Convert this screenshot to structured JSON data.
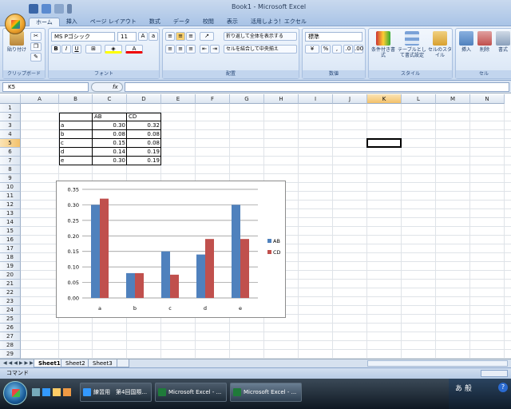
{
  "window": {
    "title": "Book1 - Microsoft Excel"
  },
  "ribbon": {
    "tabs": [
      "ホーム",
      "挿入",
      "ページ レイアウト",
      "数式",
      "データ",
      "校閲",
      "表示",
      "活用しよう！エクセル"
    ],
    "clipboard": {
      "paste_label": "貼り付け",
      "group_label": "クリップボード"
    },
    "font": {
      "name": "MS Pゴシック",
      "size": "11",
      "bold": "B",
      "italic": "I",
      "underline": "U",
      "group_label": "フォント"
    },
    "alignment": {
      "wrap_label": "折り返して全体を表示する",
      "merge_label": "セルを結合して中央揃え",
      "group_label": "配置"
    },
    "number": {
      "format": "標準",
      "group_label": "数値"
    },
    "styles": {
      "conditional_label": "条件付き書式",
      "table_label": "テーブルとして書式設定",
      "cell_styles_label": "セルのスタイル",
      "group_label": "スタイル"
    },
    "cells": {
      "insert_label": "挿入",
      "delete_label": "削除",
      "format_label": "書式",
      "group_label": "セル"
    }
  },
  "formula_bar": {
    "name_box": "K5",
    "fx": "fx",
    "content": ""
  },
  "columns": [
    "A",
    "B",
    "C",
    "D",
    "E",
    "F",
    "G",
    "H",
    "I",
    "J",
    "K",
    "L",
    "M",
    "N"
  ],
  "selected_column": "K",
  "rows": [
    "1",
    "2",
    "3",
    "4",
    "5",
    "6",
    "7",
    "8",
    "9",
    "10",
    "11",
    "12",
    "13",
    "14",
    "15",
    "16",
    "17",
    "18",
    "19",
    "20",
    "21",
    "22",
    "23",
    "24",
    "25",
    "26",
    "27",
    "28",
    "29"
  ],
  "selected_row": "5",
  "table": {
    "headers": [
      "AB",
      "CD"
    ],
    "rows": [
      {
        "label": "a",
        "ab": "0.30",
        "cd": "0.32"
      },
      {
        "label": "b",
        "ab": "0.08",
        "cd": "0.08"
      },
      {
        "label": "c",
        "ab": "0.15",
        "cd": "0.08"
      },
      {
        "label": "d",
        "ab": "0.14",
        "cd": "0.19"
      },
      {
        "label": "e",
        "ab": "0.30",
        "cd": "0.19"
      }
    ]
  },
  "chart_data": {
    "type": "bar",
    "categories": [
      "a",
      "b",
      "c",
      "d",
      "e"
    ],
    "series": [
      {
        "name": "AB",
        "values": [
          0.3,
          0.08,
          0.15,
          0.14,
          0.3
        ],
        "color": "#4f81bd"
      },
      {
        "name": "CD",
        "values": [
          0.32,
          0.08,
          0.075,
          0.19,
          0.19
        ],
        "color": "#c0504d"
      }
    ],
    "ylim": [
      0,
      0.35
    ],
    "yticks": [
      "0.00",
      "0.05",
      "0.10",
      "0.15",
      "0.20",
      "0.25",
      "0.30",
      "0.35"
    ],
    "grid": true,
    "legend": "right"
  },
  "sheets": [
    "Sheet1",
    "Sheet2",
    "Sheet3"
  ],
  "active_sheet": "Sheet1",
  "status": {
    "mode": "コマンド"
  },
  "taskbar": {
    "items": [
      "練習用　第4回国際...",
      "Microsoft Excel - ...",
      "Microsoft Excel - ..."
    ],
    "active_index": 2,
    "tray_text": "あ 般"
  },
  "colors": {
    "accent": "#4f81bd",
    "selection": "#f3c16a"
  }
}
